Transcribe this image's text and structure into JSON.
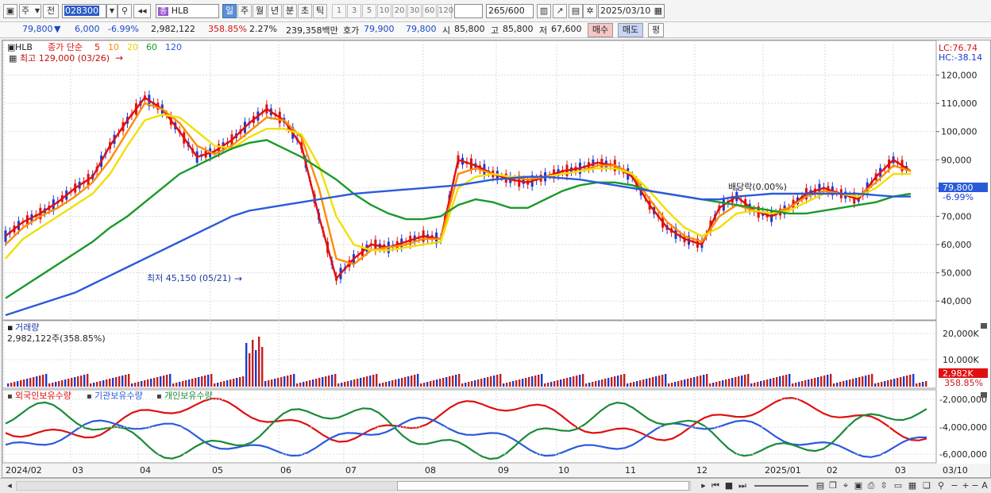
{
  "toolbar": {
    "period_selector": "주",
    "prev_label": "전",
    "stock_code": "028300",
    "stock_name": "HLB",
    "stock_badge": "종",
    "periods": [
      "일",
      "주",
      "월",
      "년",
      "분",
      "초",
      "틱"
    ],
    "active_period": "일",
    "number_buttons": [
      "1",
      "3",
      "5",
      "10",
      "20",
      "30",
      "60",
      "120"
    ],
    "count": "265",
    "count_total": "/600",
    "date": "2025/03/10"
  },
  "quote": {
    "price": "79,800",
    "arrow": "▼",
    "change": "6,000",
    "change_pct": "-6.99%",
    "volume": "2,982,122",
    "volume_ratio": "358.85%",
    "turnover": "2.27%",
    "amount": "239,358백만",
    "ask_label": "호가",
    "ask": "79,900",
    "bid": "79,800",
    "open_label": "시",
    "open": "85,800",
    "high_label": "고",
    "high": "85,800",
    "low_label": "저",
    "low": "67,600",
    "buy_label": "매수",
    "sell_label": "매도",
    "eval_label": "평"
  },
  "price_panel": {
    "title": "HLB",
    "ma_label": "종가 단순",
    "ma_periods": [
      {
        "label": "5",
        "color": "#e01010"
      },
      {
        "label": "10",
        "color": "#ff8c00"
      },
      {
        "label": "20",
        "color": "#e8d000"
      },
      {
        "label": "60",
        "color": "#1a9a2a"
      },
      {
        "label": "120",
        "color": "#2a5adc"
      }
    ],
    "max_label": "최고 129,000 (03/26)",
    "min_label": "최저 45,150 (05/21)",
    "dividend_label": "배당락(0.00%)",
    "lc_label": "LC:76.74",
    "hc_label": "HC:-38.14",
    "y_ticks": [
      "120,000",
      "110,000",
      "100,000",
      "90,000",
      "80,000",
      "70,000",
      "60,000",
      "50,000",
      "40,000"
    ],
    "current_price_tag": "79,800",
    "current_change_tag": "-6.99%"
  },
  "volume_panel": {
    "title": "거래량",
    "value_label": "2,982,122주(358.85%)",
    "y_ticks": [
      "20,000K",
      "10,000K"
    ],
    "tag_value": "2,982K",
    "tag_pct": "358.85%"
  },
  "holding_panel": {
    "legend": [
      {
        "label": "외국인보유수량",
        "color": "#e01010"
      },
      {
        "label": "기관보유수량",
        "color": "#2a5adc"
      },
      {
        "label": "개인보유수량",
        "color": "#1a8a3a"
      }
    ],
    "y_ticks": [
      "-2,000,000",
      "-4,000,000",
      "-6,000,000"
    ]
  },
  "x_axis": {
    "labels": [
      "2024/02",
      "03",
      "04",
      "05",
      "06",
      "07",
      "08",
      "09",
      "10",
      "11",
      "12",
      "2025/01",
      "02",
      "03",
      "03/10"
    ]
  },
  "chart_data": [
    {
      "type": "line",
      "title": "HLB",
      "series": [
        {
          "name": "5",
          "values": [
            63000,
            68000,
            71000,
            75000,
            80000,
            84000,
            95000,
            104000,
            112000,
            108000,
            100000,
            91000,
            93000,
            97000,
            103000,
            108000,
            104000,
            95000,
            70000,
            48000,
            55000,
            60000,
            59000,
            61000,
            63000,
            62000,
            90000,
            88000,
            85000,
            83000,
            82000,
            84000,
            86000,
            87000,
            89000,
            88000,
            84000,
            74000,
            66000,
            62000,
            60000,
            73000,
            77000,
            72000,
            70000,
            73000,
            78000,
            80000,
            78000,
            76000,
            84000,
            90000,
            86000
          ]
        },
        {
          "name": "10",
          "values": [
            60000,
            66000,
            70000,
            73000,
            77000,
            82000,
            90000,
            100000,
            110000,
            108000,
            103000,
            95000,
            92000,
            95000,
            100000,
            105000,
            104000,
            98000,
            80000,
            55000,
            53000,
            58000,
            59000,
            60000,
            62000,
            62000,
            85000,
            87000,
            85000,
            84000,
            83000,
            84000,
            85000,
            86000,
            88000,
            88000,
            85000,
            76000,
            68000,
            63000,
            61000,
            70000,
            74000,
            72000,
            71000,
            73000,
            77000,
            79000,
            78000,
            77000,
            82000,
            88000,
            86000
          ]
        },
        {
          "name": "20",
          "values": [
            55000,
            62000,
            66000,
            70000,
            74000,
            78000,
            85000,
            95000,
            104000,
            106000,
            105000,
            100000,
            95000,
            94000,
            98000,
            101000,
            101000,
            99000,
            88000,
            70000,
            60000,
            58000,
            58000,
            59000,
            60000,
            61000,
            80000,
            84000,
            85000,
            84000,
            84000,
            84000,
            85000,
            86000,
            87000,
            87000,
            85000,
            79000,
            72000,
            66000,
            63000,
            66000,
            71000,
            72000,
            71000,
            72000,
            75000,
            78000,
            78000,
            77000,
            80000,
            85000,
            85000
          ]
        },
        {
          "name": "60",
          "values": [
            41000,
            45000,
            49000,
            53000,
            57000,
            61000,
            66000,
            70000,
            75000,
            80000,
            85000,
            88000,
            91000,
            94000,
            96000,
            97000,
            94000,
            91000,
            87000,
            83000,
            78000,
            74000,
            71000,
            69000,
            69000,
            70000,
            74000,
            76000,
            75000,
            73000,
            73000,
            76000,
            79000,
            81000,
            82000,
            82000,
            81000,
            79000,
            78000,
            77000,
            76000,
            75000,
            74000,
            73000,
            72000,
            71000,
            71000,
            72000,
            73000,
            74000,
            75000,
            77000,
            78000
          ]
        },
        {
          "name": "120",
          "values": [
            35000,
            37000,
            39000,
            41000,
            43000,
            46000,
            49000,
            52000,
            55000,
            58000,
            61000,
            64000,
            67000,
            70000,
            72000,
            73000,
            74000,
            75000,
            76000,
            77000,
            78000,
            78500,
            79000,
            79500,
            80000,
            80500,
            81000,
            82000,
            83000,
            83500,
            84000,
            84000,
            83500,
            83000,
            82000,
            81000,
            80000,
            79000,
            78000,
            77000,
            76000,
            76000,
            77000,
            77500,
            78000,
            78000,
            78000,
            78000,
            78000,
            78000,
            77500,
            77000,
            77000
          ]
        }
      ],
      "ylim": [
        35000,
        130000
      ],
      "ylabel": ""
    }
  ]
}
